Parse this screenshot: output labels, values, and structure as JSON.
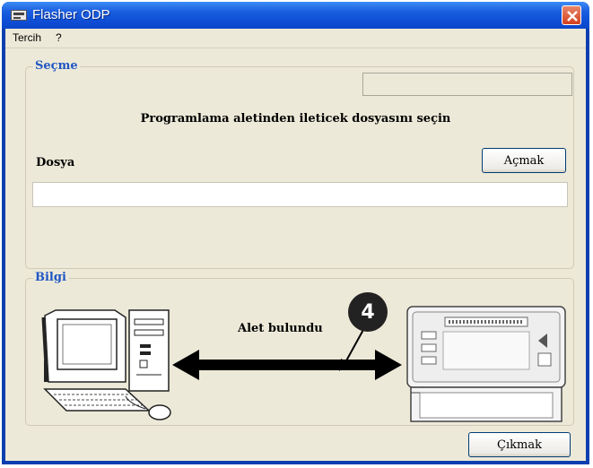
{
  "window": {
    "title": "Flasher ODP"
  },
  "menu": {
    "items": [
      "Tercih",
      "?"
    ]
  },
  "selection_group": {
    "title": "Seçme",
    "status_value": "",
    "instruction": "Programlama aletinden ileticek dosyasını seçin",
    "file_label": "Dosya",
    "open_button": "Açmak",
    "file_path_value": ""
  },
  "info_group": {
    "title": "Bilgi",
    "device_status": "Alet bulundu",
    "callout_number": "4"
  },
  "footer": {
    "exit_button": "Çıkmak"
  },
  "icons": {
    "app": "flasher-app-icon",
    "close": "close-icon",
    "computer": "computer-illustration",
    "device": "programming-device-illustration",
    "connection": "double-arrow-icon"
  },
  "colors": {
    "titlebar": "#0e4fd6",
    "group_title": "#1f56c4",
    "close_button": "#d3401c",
    "window_bg": "#ece9d8"
  }
}
